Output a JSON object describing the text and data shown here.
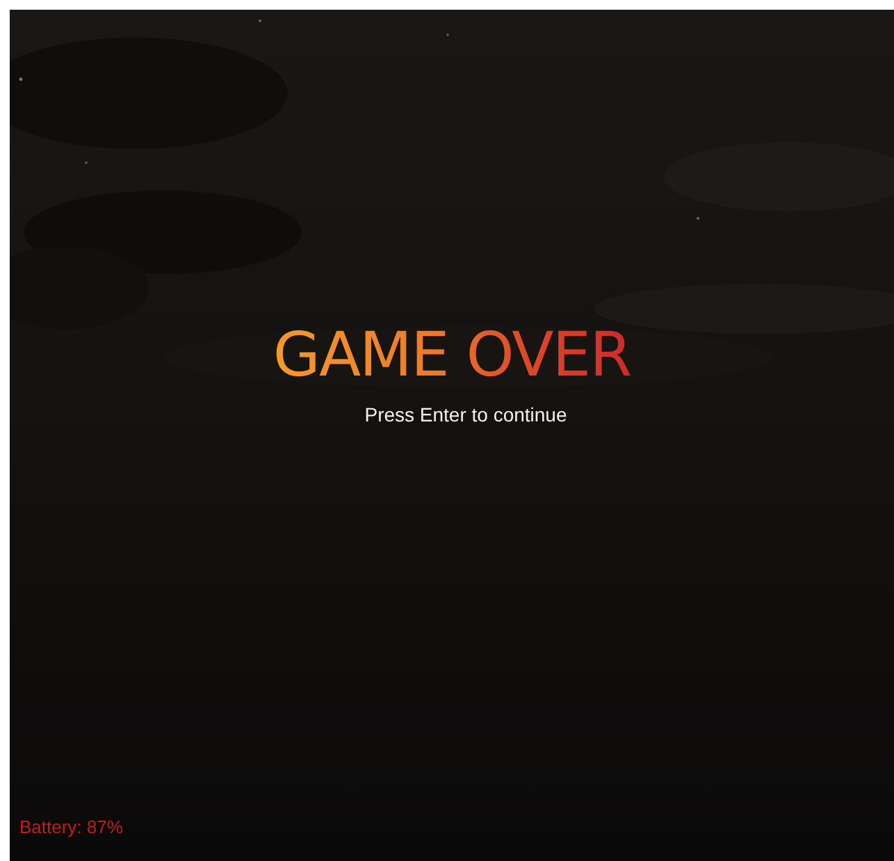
{
  "title": "GAME OVER",
  "prompt": "Press Enter to continue",
  "hud": {
    "battery": "Battery: 87%"
  }
}
